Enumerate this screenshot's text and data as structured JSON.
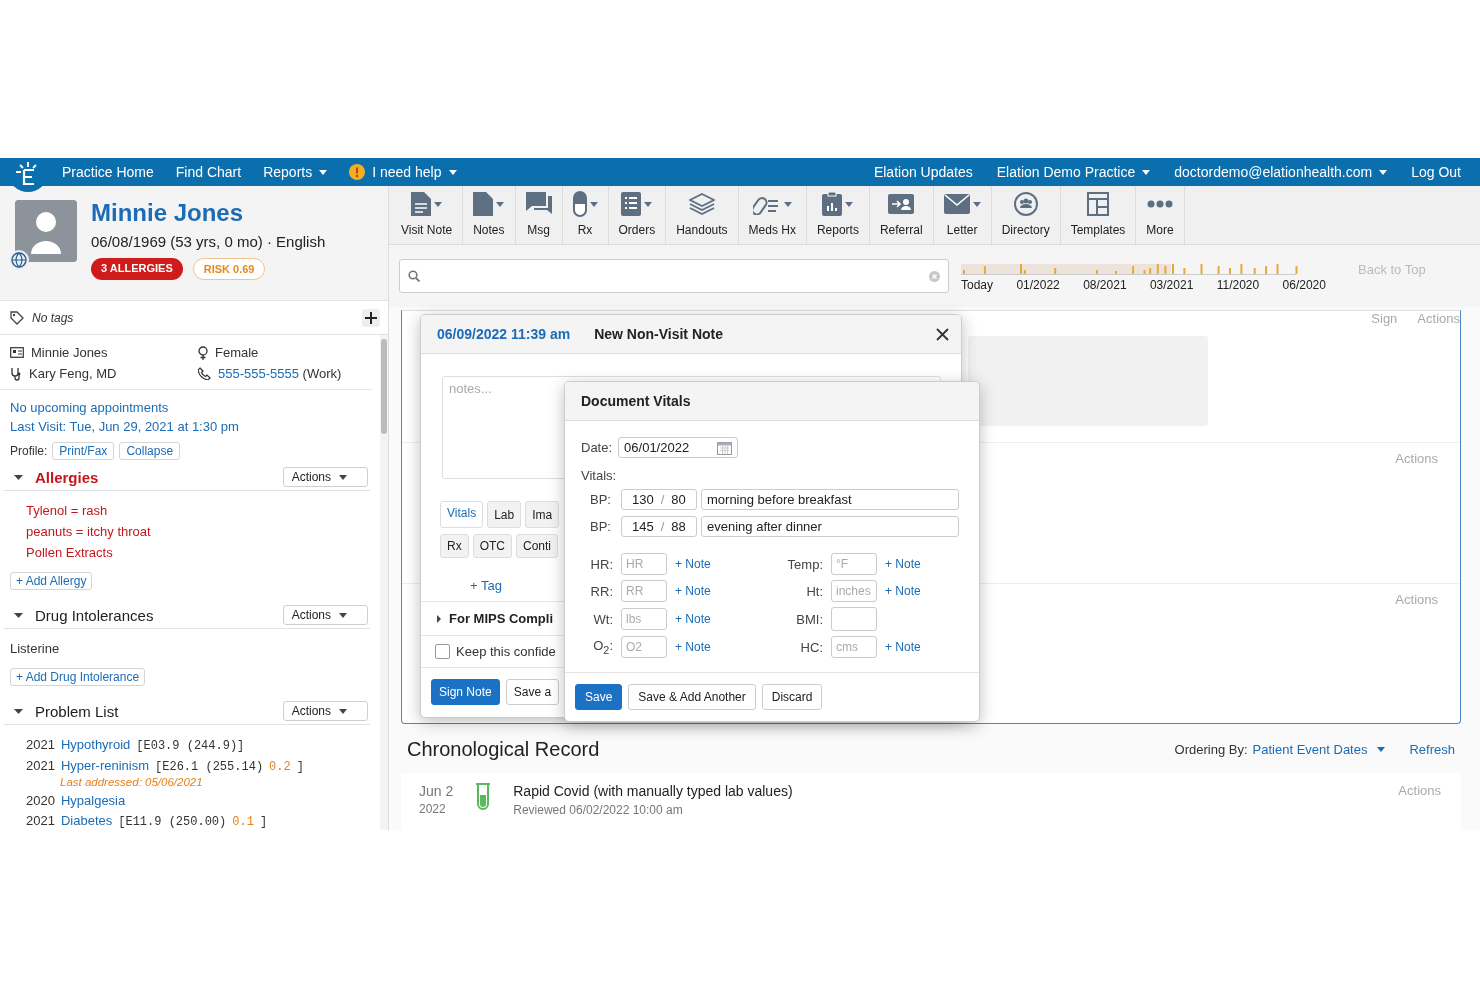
{
  "nav": {
    "links": [
      {
        "label": "Practice Home",
        "dropdown": false,
        "alert": false
      },
      {
        "label": "Find Chart",
        "dropdown": false,
        "alert": false
      },
      {
        "label": "Reports",
        "dropdown": true,
        "alert": false
      },
      {
        "label": "I need help",
        "dropdown": true,
        "alert": true
      }
    ],
    "right": [
      {
        "label": "Elation Updates",
        "dropdown": false
      },
      {
        "label": "Elation Demo Practice",
        "dropdown": true
      },
      {
        "label": "doctordemo@elationhealth.com",
        "dropdown": true
      },
      {
        "label": "Log Out",
        "dropdown": false
      }
    ]
  },
  "patient": {
    "name": "Minnie Jones",
    "details": "06/08/1969 (53 yrs, 0 mo) · English",
    "badges": [
      {
        "label": "3 ALLERGIES",
        "kind": "alert"
      },
      {
        "label": "RISK 0.69",
        "kind": "risk"
      }
    ]
  },
  "tags": {
    "label": "No tags"
  },
  "demographics": {
    "name": "Minnie Jones",
    "provider": "Kary Feng, MD",
    "sex": "Female",
    "phone": "555-555-5555",
    "phone_type": "(Work)"
  },
  "appointments": {
    "upcoming": "No upcoming appointments",
    "last_visit": "Last Visit: Tue, Jun 29, 2021 at 1:30 pm"
  },
  "profile": {
    "label": "Profile:",
    "buttons": [
      "Print/Fax",
      "Collapse"
    ]
  },
  "sections": [
    {
      "title": "Allergies",
      "kind": "allergies",
      "expanded": true,
      "actions": "Actions",
      "items": [
        "Tylenol = rash",
        "peanuts = itchy throat",
        "Pollen Extracts"
      ],
      "add": "+ Add Allergy"
    },
    {
      "title": "Drug Intolerances",
      "kind": "plain",
      "expanded": true,
      "actions": "Actions",
      "items": [
        "Listerine"
      ],
      "add": "+ Add Drug Intolerance"
    },
    {
      "title": "Problem List",
      "kind": "problems",
      "expanded": true,
      "actions": "Actions",
      "problems": [
        {
          "year": "2021",
          "name": "Hypothyroid",
          "code": "[E03.9 (244.9)]"
        },
        {
          "year": "2021",
          "name": "Hyper-reninism",
          "code": "[E26.1 (255.14)",
          "score": "0.2",
          "close": "]",
          "note": "Last addressed: 05/06/2021"
        },
        {
          "year": "2020",
          "name": "Hypalgesia"
        },
        {
          "year": "2021",
          "name": "Diabetes",
          "code": "[E11.9 (250.00)",
          "score": "0.1",
          "close": "]"
        }
      ]
    }
  ],
  "toolbar": [
    {
      "label": "Visit Note",
      "dropdown": true
    },
    {
      "label": "Notes",
      "dropdown": true
    },
    {
      "label": "Msg",
      "dropdown": false
    },
    {
      "label": "Rx",
      "dropdown": true
    },
    {
      "label": "Orders",
      "dropdown": true
    },
    {
      "label": "Handouts",
      "dropdown": false
    },
    {
      "label": "Meds Hx",
      "dropdown": true
    },
    {
      "label": "Reports",
      "dropdown": true
    },
    {
      "label": "Referral",
      "dropdown": false
    },
    {
      "label": "Letter",
      "dropdown": true
    },
    {
      "label": "Directory",
      "dropdown": false
    },
    {
      "label": "Templates",
      "dropdown": false
    },
    {
      "label": "More",
      "dropdown": false
    }
  ],
  "timeline": {
    "labels": [
      "Today",
      "01/2022",
      "08/2021",
      "03/2021",
      "11/2020",
      "06/2020"
    ],
    "back_to_top": "Back to Top"
  },
  "background_entries": [
    {
      "actions": [
        "Sign",
        "Actions"
      ],
      "kind": "form"
    },
    {
      "actions": [
        "Actions"
      ],
      "kind": "plain"
    },
    {
      "actions": [
        "Actions"
      ],
      "kind": "plain"
    }
  ],
  "note_dialog": {
    "timestamp": "06/09/2022 11:39 am",
    "title": "New Non-Visit Note",
    "placeholder": "notes...",
    "tag_rows": [
      [
        {
          "label": "Vitals",
          "selected": true
        },
        {
          "label": "Lab",
          "selected": false
        },
        {
          "label": "Ima",
          "selected": false
        }
      ],
      [
        {
          "label": "Rx",
          "selected": false
        },
        {
          "label": "OTC",
          "selected": false
        },
        {
          "label": "Conti",
          "selected": false
        }
      ]
    ],
    "add_tag": "+ Tag",
    "mips": {
      "label": "For MIPS Compli",
      "expanded": false
    },
    "confidential": {
      "label": "Keep this confide",
      "checked": false
    },
    "buttons": [
      {
        "label": "Sign Note",
        "kind": "primary"
      },
      {
        "label": "Save a",
        "kind": "default"
      }
    ]
  },
  "vitals_dialog": {
    "title": "Document Vitals",
    "date_label": "Date:",
    "date": "06/01/2022",
    "vitals_label": "Vitals:",
    "bp": [
      {
        "label": "BP:",
        "systolic": "130",
        "separator": "/",
        "diastolic": "80",
        "note": "morning before breakfast"
      },
      {
        "label": "BP:",
        "systolic": "145",
        "separator": "/",
        "diastolic": "88",
        "note": "evening after dinner"
      }
    ],
    "fields": [
      {
        "label": "HR:",
        "placeholder": "HR",
        "note": "+ Note"
      },
      {
        "label": "Temp:",
        "placeholder": "°F",
        "note": "+ Note"
      },
      {
        "label": "RR:",
        "placeholder": "RR",
        "note": "+ Note"
      },
      {
        "label": "Ht:",
        "placeholder": "inches",
        "note": "+ Note"
      },
      {
        "label": "Wt:",
        "placeholder": "lbs",
        "note": "+ Note"
      },
      {
        "label": "BMI:"
      },
      {
        "label": "O$_{2}$:",
        "placeholder": "O2",
        "note": "+ Note"
      },
      {
        "label": "HC:",
        "placeholder": "cms",
        "note": "+ Note"
      }
    ],
    "buttons": [
      {
        "label": "Save",
        "kind": "primary"
      },
      {
        "label": "Save & Add Another",
        "kind": "default"
      },
      {
        "label": "Discard",
        "kind": "default"
      }
    ]
  },
  "chronological": {
    "title": "Chronological Record",
    "ordering_label": "Ordering By:",
    "ordering_value": "Patient Event Dates",
    "refresh": "Refresh",
    "entries": [
      {
        "month_day": "Jun 2",
        "year": "2022",
        "title": "Rapid Covid (with manually typed lab values)",
        "subtitle": "Reviewed 06/02/2022 10:00 am",
        "actions": "Actions"
      }
    ]
  }
}
